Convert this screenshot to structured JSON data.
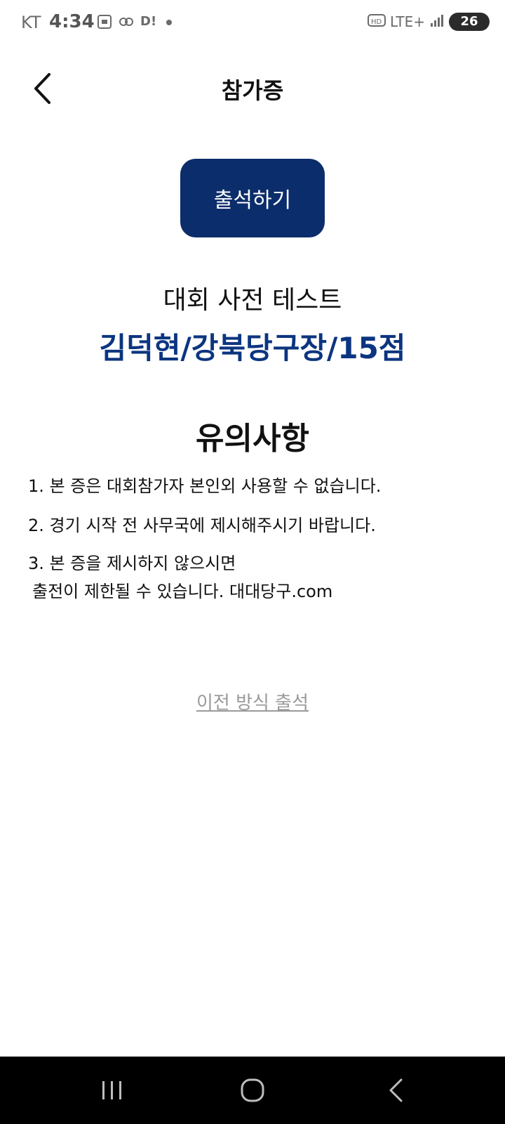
{
  "status_bar": {
    "carrier": "KT",
    "time": "4:34",
    "icons": [
      "screenshot-icon",
      "link-icon",
      "notification-d-icon",
      "dot-icon"
    ],
    "right_text": "LTE+",
    "battery": "26"
  },
  "header": {
    "back_icon": "chevron-left-icon",
    "title": "참가증"
  },
  "attend_button": {
    "label": "출석하기",
    "color": "#0c2d6b"
  },
  "event": {
    "name": "대회 사전 테스트",
    "participant": "김덕현/강북당구장/15점",
    "participant_color": "#0c3580"
  },
  "notice": {
    "heading": "유의사항",
    "items": [
      "1. 본 증은 대회참가자 본인외 사용할 수 없습니다.",
      "2. 경기 시작 전 사무국에 제시해주시기 바랍니다.",
      "3. 본 증을 제시하지 않으시면",
      "출전이 제한될 수 있습니다. 대대당구.com"
    ]
  },
  "legacy_link": {
    "label": "이전 방식 출석"
  },
  "nav_bar": {
    "buttons": [
      "recents-icon",
      "home-icon",
      "back-icon"
    ]
  }
}
